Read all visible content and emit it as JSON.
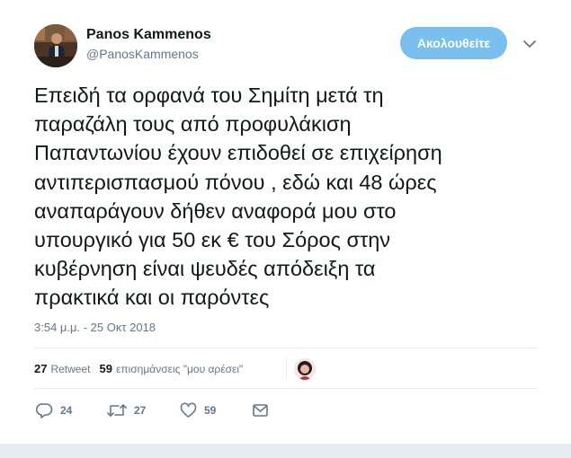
{
  "author": {
    "display_name": "Panos Kammenos",
    "handle": "@PanosKammenos"
  },
  "follow_button": {
    "label": "Ακολουθείτε"
  },
  "tweet": {
    "lines": [
      "Επειδή τα ορφανά του Σημίτη μετά τη",
      "παραζάλη τους από προφυλάκιση",
      "Παπαντωνίου έχουν επιδοθεί σε επιχείρηση",
      "αντιπερισπασμού πόνου , εδώ και 48 ώρες",
      "αναπαράγουν δήθεν αναφορά μου στο",
      "υπουργικό για 50 εκ € του Σόρος στην",
      "κυβέρνηση είναι ψευδές απόδειξη τα",
      "πρακτικά και οι παρόντες"
    ],
    "timestamp": "3:54 μ.μ. - 25 Οκτ 2018"
  },
  "stats": {
    "retweets_count": "27",
    "retweets_label": "Retweet",
    "likes_count": "59",
    "likes_label": "επισημάνσεις \"μου αρέσει\""
  },
  "actions": {
    "reply_count": "24",
    "retweet_count": "27",
    "like_count": "59"
  },
  "icons": {
    "reply": "reply-icon",
    "retweet": "retweet-icon",
    "like": "heart-icon",
    "message": "envelope-icon",
    "menu": "chevron-down-icon"
  },
  "colors": {
    "follow_button": "#79c0f1",
    "secondary_text": "#657786",
    "divider": "#e6ecf0"
  }
}
